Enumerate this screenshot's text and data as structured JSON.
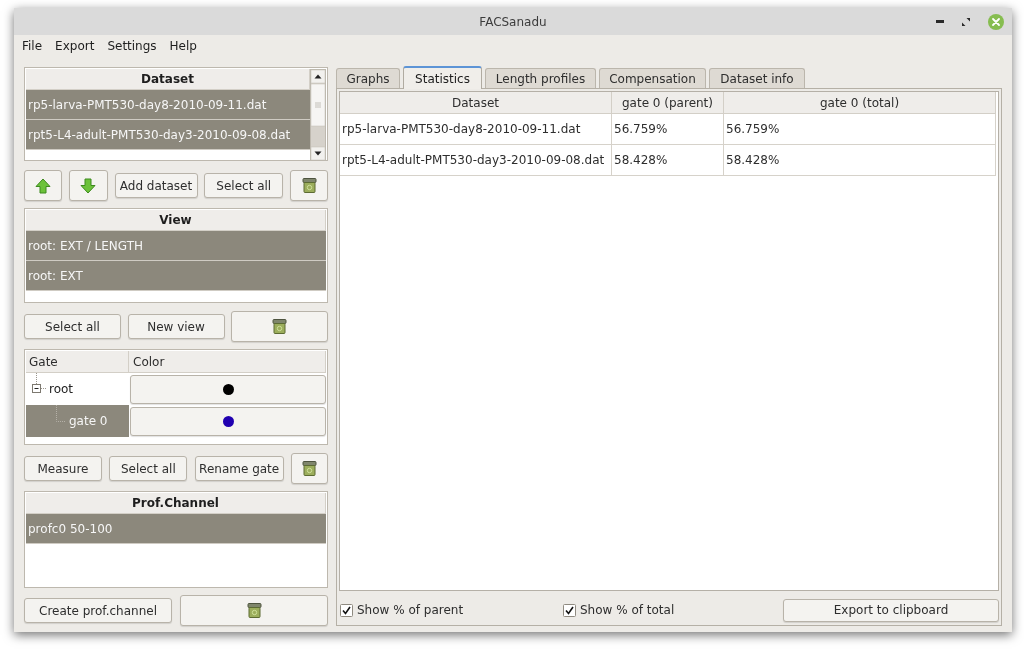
{
  "window": {
    "title": "FACSanadu"
  },
  "menu": [
    "File",
    "Export",
    "Settings",
    "Help"
  ],
  "dataset_list": {
    "header": "Dataset",
    "items": [
      {
        "label": "rp5-larva-PMT530-day8-2010-09-11.dat",
        "selected": true
      },
      {
        "label": "rpt5-L4-adult-PMT530-day3-2010-09-08.dat",
        "selected": true
      }
    ]
  },
  "dataset_buttons": [
    {
      "kind": "move_up"
    },
    {
      "kind": "move_down"
    },
    {
      "kind": "text",
      "label": "Add dataset"
    },
    {
      "kind": "text",
      "label": "Select all"
    },
    {
      "kind": "delete"
    }
  ],
  "view_list": {
    "header": "View",
    "items": [
      {
        "label": "root: EXT / LENGTH",
        "selected": true
      },
      {
        "label": "root: EXT",
        "selected": true
      }
    ]
  },
  "view_buttons": [
    {
      "kind": "text",
      "label": "Select all"
    },
    {
      "kind": "text",
      "label": "New view"
    },
    {
      "kind": "delete"
    }
  ],
  "gate_tree": {
    "columns": [
      "Gate",
      "Color"
    ],
    "items": [
      {
        "label": "root",
        "color": "#000000",
        "selected": false,
        "expanded": true,
        "children": [
          {
            "label": "gate 0",
            "color": "#2000b0",
            "selected": true
          }
        ]
      }
    ]
  },
  "gate_buttons": [
    {
      "kind": "text",
      "label": "Measure"
    },
    {
      "kind": "text",
      "label": "Select all"
    },
    {
      "kind": "text",
      "label": "Rename gate"
    },
    {
      "kind": "delete"
    }
  ],
  "profile_channel_list": {
    "header": "Prof.Channel",
    "items": [
      {
        "label": "profc0 50-100",
        "selected": true
      }
    ]
  },
  "profile_channel_buttons": [
    {
      "kind": "text",
      "label": "Create prof.channel"
    },
    {
      "kind": "delete"
    }
  ],
  "tabs": [
    {
      "label": "Graphs",
      "selected": false
    },
    {
      "label": "Statistics",
      "selected": true
    },
    {
      "label": "Length profiles",
      "selected": false
    },
    {
      "label": "Compensation",
      "selected": false
    },
    {
      "label": "Dataset info",
      "selected": false
    }
  ],
  "statistics_table": {
    "columns": [
      "Dataset",
      "gate 0 (parent)",
      "gate 0 (total)"
    ],
    "rows": [
      [
        "rp5-larva-PMT530-day8-2010-09-11.dat",
        "56.759%",
        "56.759%"
      ],
      [
        "rpt5-L4-adult-PMT530-day3-2010-09-08.dat",
        "58.428%",
        "58.428%"
      ]
    ]
  },
  "options": [
    {
      "label": "Show % of parent",
      "checked": true
    },
    {
      "label": "Show % of total",
      "checked": true
    }
  ],
  "export_button": {
    "label": "Export to clipboard"
  }
}
